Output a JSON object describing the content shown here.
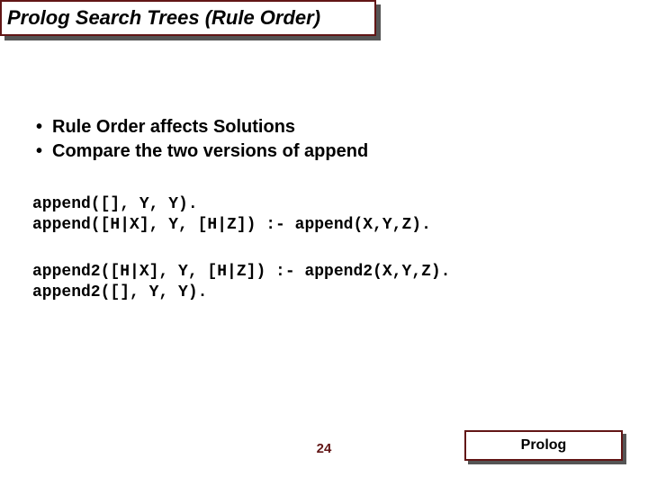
{
  "title": "Prolog Search Trees (Rule Order)",
  "bullets": [
    "Rule Order affects Solutions",
    "Compare the two versions of append"
  ],
  "code1": {
    "line1": "append([], Y, Y).",
    "line2": "append([H|X], Y, [H|Z]) :- append(X,Y,Z)."
  },
  "code2": {
    "line1": "append2([H|X], Y, [H|Z]) :- append2(X,Y,Z).",
    "line2": "append2([], Y, Y)."
  },
  "footer": {
    "page": "24",
    "label": "Prolog"
  }
}
